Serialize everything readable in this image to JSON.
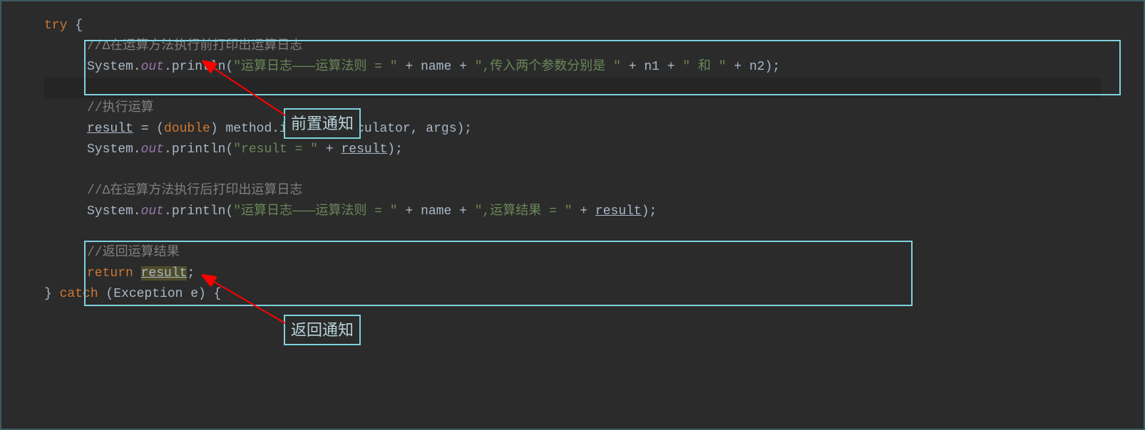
{
  "code": {
    "line1_try": "try ",
    "line1_brace": "{",
    "line2_comment": "//Δ在运算方法执行前打印出运算日志",
    "line3_system": "System.",
    "line3_out": "out",
    "line3_println": ".println(",
    "line3_str1": "\"运算日志———运算法则 = \"",
    "line3_plus1": " + name + ",
    "line3_str2": "\",传入两个参数分别是 \"",
    "line3_plus2": " + n1 + ",
    "line3_str3": "\" 和 \"",
    "line3_plus3": " + n2);",
    "line5_comment": "//执行运算",
    "line6_result": "result",
    "line6_eq": " = (",
    "line6_double": "double",
    "line6_invoke": ") method.invoke(calculator, args);",
    "line7_system": "System.",
    "line7_out": "out",
    "line7_println": ".println(",
    "line7_str1": "\"result = \"",
    "line7_plus": " + ",
    "line7_result": "result",
    "line7_end": ");",
    "line9_comment": "//Δ在运算方法执行后打印出运算日志",
    "line10_system": "System.",
    "line10_out": "out",
    "line10_println": ".println(",
    "line10_str1": "\"运算日志———运算法则 = \"",
    "line10_plus1": " + name + ",
    "line10_str2": "\",运算结果 = \"",
    "line10_plus2": " + ",
    "line10_result": "result",
    "line10_end": ");",
    "line12_comment": "//返回运算结果",
    "line13_return": "return ",
    "line13_result": "result",
    "line13_semi": ";",
    "line14_brace": "} ",
    "line14_catch": "catch ",
    "line14_paren": "(Exception e) {"
  },
  "annotations": {
    "label1": "前置通知",
    "label2": "返回通知"
  }
}
